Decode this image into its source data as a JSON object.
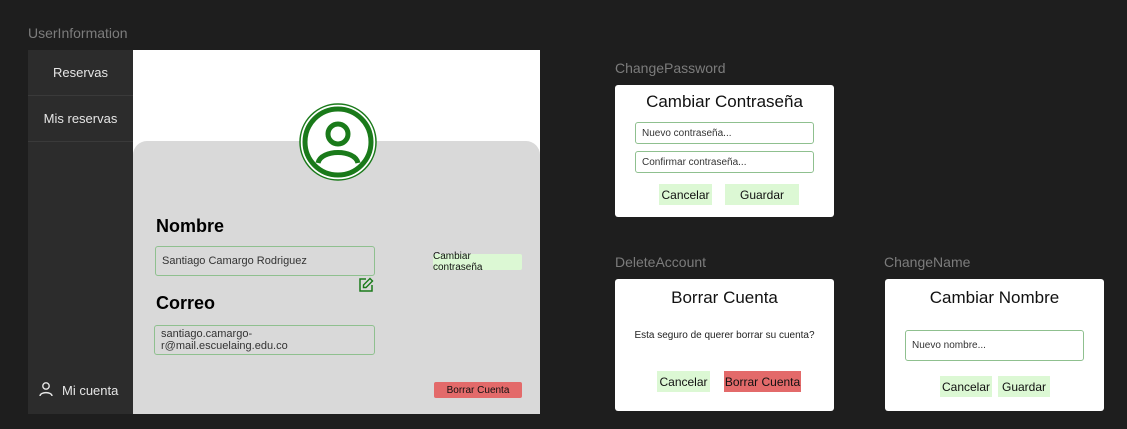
{
  "frames": {
    "user_information": "UserInformation",
    "change_password": "ChangePassword",
    "delete_account": "DeleteAccount",
    "change_name": "ChangeName"
  },
  "sidebar": {
    "items": [
      {
        "label": "Reservas"
      },
      {
        "label": "Mis reservas"
      }
    ],
    "account_label": "Mi cuenta",
    "account_icon": "person-icon"
  },
  "profile": {
    "name_title": "Nombre",
    "name_value": "Santiago Camargo Rodriguez",
    "email_title": "Correo",
    "email_value": "santiago.camargo-r@mail.escuelaing.edu.co",
    "change_password_button": "Cambiar contraseña",
    "delete_account_button": "Borrar Cuenta"
  },
  "change_password_dialog": {
    "title": "Cambiar Contraseña",
    "new_password_placeholder": "Nuevo contraseña...",
    "confirm_password_placeholder": "Confirmar contraseña...",
    "cancel": "Cancelar",
    "save": "Guardar"
  },
  "delete_account_dialog": {
    "title": "Borrar Cuenta",
    "message": "Esta seguro de querer borrar su cuenta?",
    "cancel": "Cancelar",
    "confirm": "Borrar Cuenta"
  },
  "change_name_dialog": {
    "title": "Cambiar Nombre",
    "new_name_placeholder": "Nuevo nombre...",
    "cancel": "Cancelar",
    "save": "Guardar"
  },
  "colors": {
    "background": "#1e1e1e",
    "accent_green": "#dcf8d4",
    "danger_red": "#e36a6a",
    "avatar_green": "#1a7a1a"
  }
}
